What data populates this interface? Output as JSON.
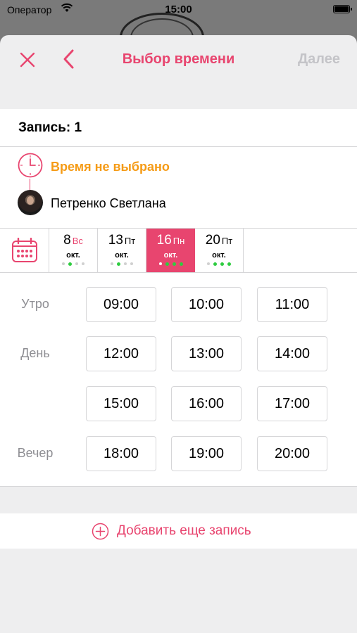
{
  "status_bar": {
    "carrier": "Оператор",
    "time": "15:00"
  },
  "nav": {
    "title": "Выбор времени",
    "next_label": "Далее"
  },
  "appointment": {
    "title": "Запись: 1",
    "time_status": "Время не выбрано",
    "specialist": "Петренко Светлана"
  },
  "dates": [
    {
      "num": "8",
      "weekday": "Вс",
      "month": "окт.",
      "selected": false,
      "weekend": true,
      "dots": [
        "grey",
        "green",
        "grey",
        "grey"
      ]
    },
    {
      "num": "13",
      "weekday": "Пт",
      "month": "окт.",
      "selected": false,
      "weekend": false,
      "dots": [
        "grey",
        "green",
        "grey",
        "grey"
      ]
    },
    {
      "num": "16",
      "weekday": "Пн",
      "month": "окт.",
      "selected": true,
      "weekend": false,
      "dots": [
        "white",
        "green",
        "green",
        "green"
      ]
    },
    {
      "num": "20",
      "weekday": "Пт",
      "month": "окт.",
      "selected": false,
      "weekend": false,
      "dots": [
        "grey",
        "green",
        "green",
        "green"
      ]
    }
  ],
  "periods": {
    "morning": "Утро",
    "day": "День",
    "evening": "Вечер"
  },
  "slots": {
    "morning": [
      "09:00",
      "10:00",
      "11:00"
    ],
    "day_1": [
      "12:00",
      "13:00",
      "14:00"
    ],
    "day_2": [
      "15:00",
      "16:00",
      "17:00"
    ],
    "evening": [
      "18:00",
      "19:00",
      "20:00"
    ]
  },
  "add_label": "Добавить еще запись",
  "colors": {
    "accent": "#e8456f",
    "warning": "#f59b16",
    "available": "#2ecc40",
    "disabled": "#c4c4c8"
  }
}
